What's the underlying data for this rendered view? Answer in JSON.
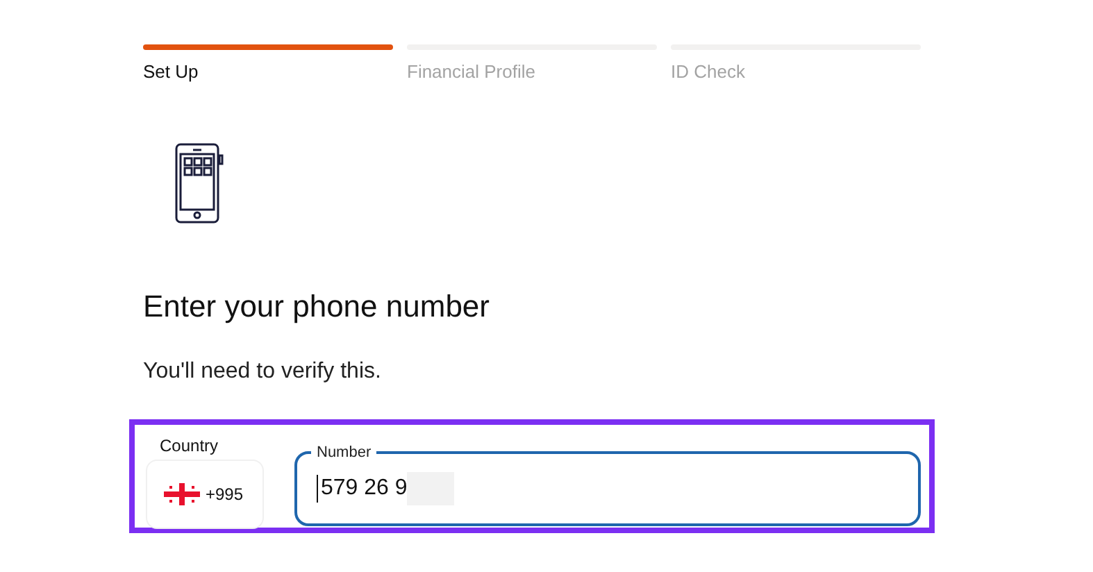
{
  "steps": [
    {
      "label": "Set Up",
      "selected": true
    },
    {
      "label": "Financial Profile",
      "selected": false
    },
    {
      "label": "ID Check",
      "selected": false
    }
  ],
  "heading": "Enter your phone number",
  "subtitle": "You'll need to verify this.",
  "country": {
    "label": "Country",
    "code": "+995"
  },
  "number": {
    "label": "Number",
    "value": "579 26 9",
    "focused": true
  }
}
